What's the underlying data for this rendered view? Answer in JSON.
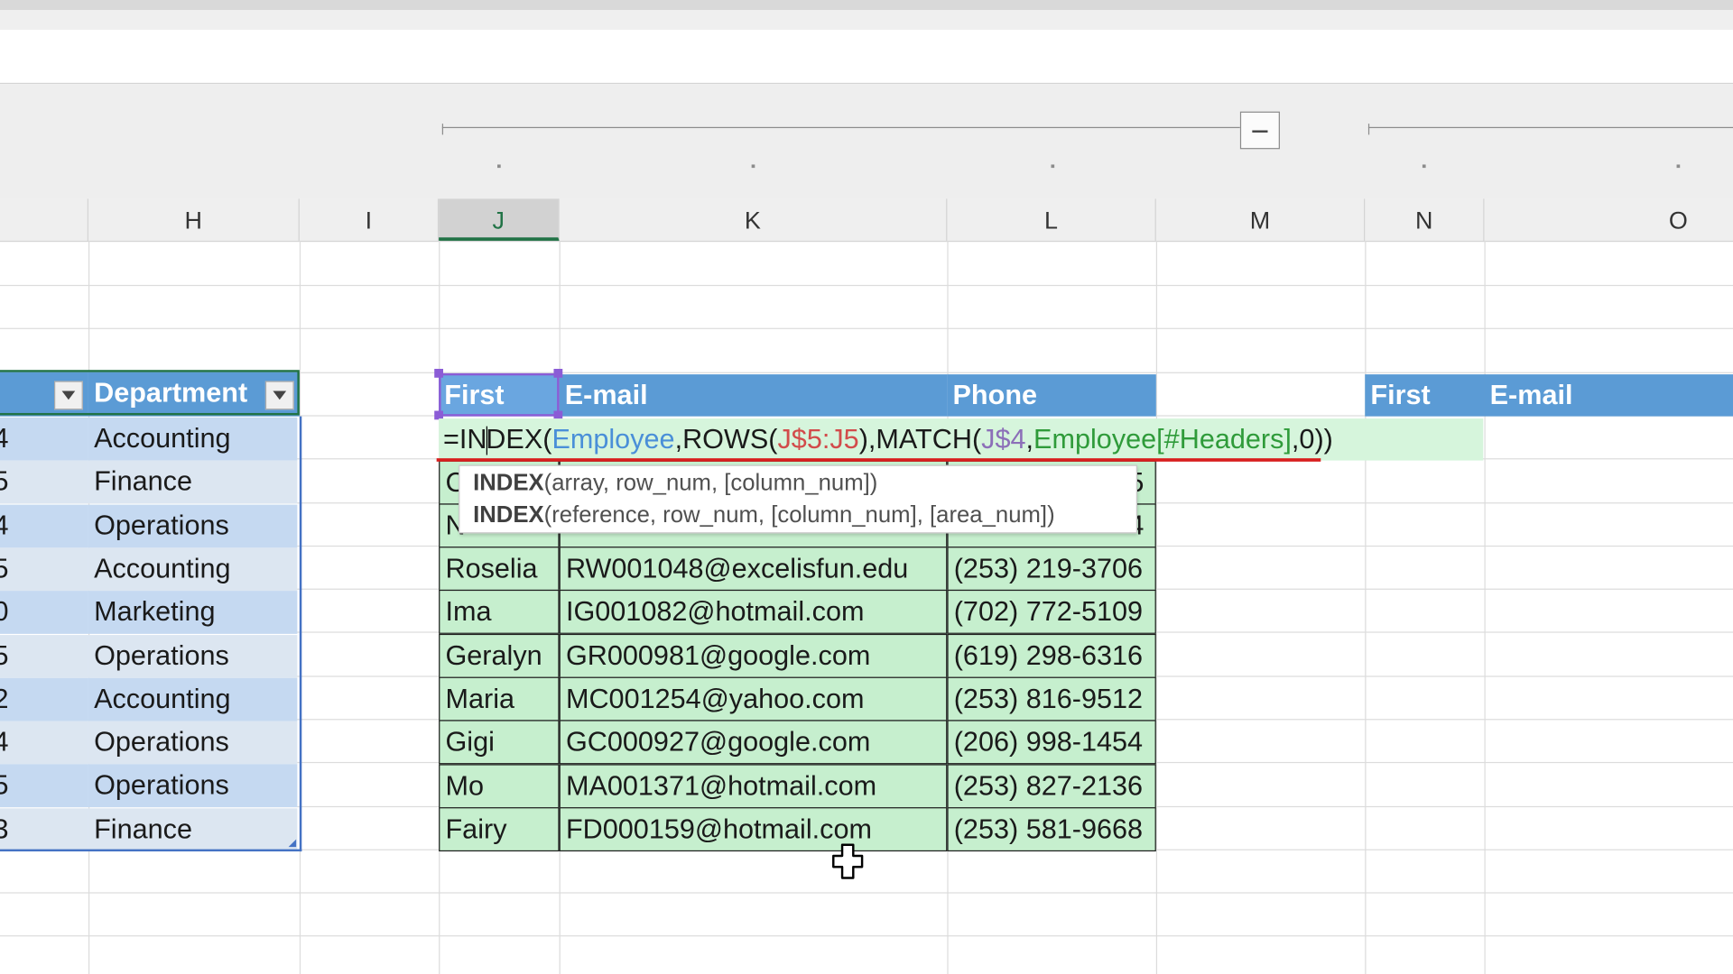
{
  "columns": [
    "H",
    "I",
    "J",
    "K",
    "L",
    "M",
    "N",
    "O"
  ],
  "employee_table": {
    "department_header": "Department",
    "departments": [
      "Accounting",
      "Finance",
      "Operations",
      "Accounting",
      "Marketing",
      "Operations",
      "Accounting",
      "Operations",
      "Operations",
      "Finance"
    ],
    "cut_ids": [
      "4",
      "5",
      "4",
      "5",
      "0",
      "5",
      "2",
      "4",
      "5",
      "3"
    ]
  },
  "lookup_table": {
    "headers": [
      "First",
      "E-mail",
      "Phone"
    ],
    "partial_first": [
      "C",
      "N"
    ],
    "rows": [
      [
        "Roselia",
        "RW001048@excelisfun.edu",
        "(253) 219-3706"
      ],
      [
        "Ima",
        "IG001082@hotmail.com",
        "(702) 772-5109"
      ],
      [
        "Geralyn",
        "GR000981@google.com",
        "(619) 298-6316"
      ],
      [
        "Maria",
        "MC001254@yahoo.com",
        "(253) 816-9512"
      ],
      [
        "Gigi",
        "GC000927@google.com",
        "(206) 998-1454"
      ],
      [
        "Mo",
        "MA001371@hotmail.com",
        "(253) 827-2136"
      ],
      [
        "Fairy",
        "FD000159@hotmail.com",
        "(253) 581-9668"
      ]
    ],
    "partial_phone_suffix": [
      "5",
      "4"
    ]
  },
  "second_table": {
    "headers": [
      "First",
      "E-mail"
    ]
  },
  "formula": {
    "p1": "=IN",
    "p2": "DEX(",
    "p3": "Employee",
    "p4": ",ROWS(",
    "p5": "J$5:J5",
    "p6": "),MATCH(",
    "p7": "J$4",
    "p8": ",",
    "p9": "Employee[#Headers]",
    "p10": ",0",
    "p11": "))"
  },
  "tooltip": {
    "fn1": "INDEX",
    "args1": "(array, row_num, [column_num])",
    "fn2": "INDEX",
    "args2": "(reference, row_num, [column_num], [area_num])"
  },
  "colors": {
    "table_header": "#5b9bd5",
    "green_fill": "#c6efce",
    "selected_column": "#217346",
    "error_underline": "#d81e1e"
  }
}
